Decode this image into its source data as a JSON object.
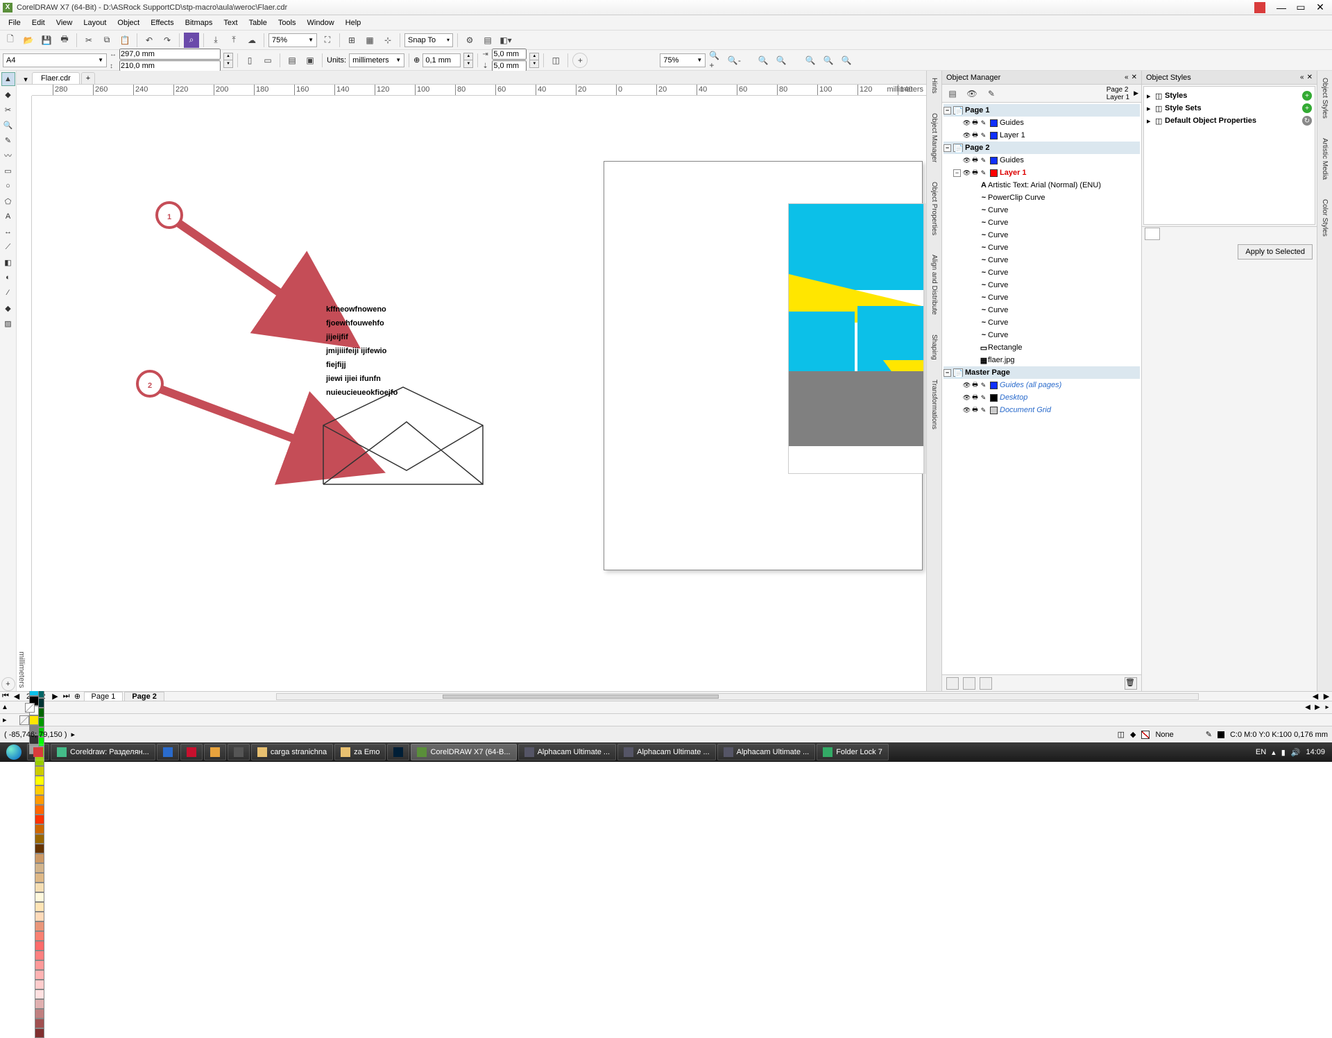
{
  "app_title": "CorelDRAW X7 (64-Bit) - D:\\ASRock SupportCD\\stp-macro\\aula\\weroc\\Flaer.cdr",
  "menu": [
    "File",
    "Edit",
    "View",
    "Layout",
    "Object",
    "Effects",
    "Bitmaps",
    "Text",
    "Table",
    "Tools",
    "Window",
    "Help"
  ],
  "zoom_main": "75%",
  "snap_label": "Snap To",
  "prop": {
    "page_size": "A4",
    "width": "297,0 mm",
    "height": "210,0 mm",
    "units_label": "Units:",
    "units_value": "millimeters",
    "nudge": "0,1 mm",
    "dup_x": "5,0 mm",
    "dup_y": "5,0 mm"
  },
  "zoom_right": "75%",
  "doc_tab": "Flaer.cdr",
  "ruler_marks": [
    280,
    260,
    240,
    220,
    200,
    180,
    160,
    140,
    120,
    100,
    80,
    60,
    40,
    20,
    0,
    20,
    40,
    60,
    80,
    100,
    120,
    140
  ],
  "ruler_unit": "millimeters",
  "canvas_text": [
    "kffneowfnoweno",
    "fjoewhfouwehfo",
    "jijeijfif",
    "jmijiiifeiji ijifewio",
    "fiejfijj",
    "jiewi ijiei ifunfn",
    "nuieucieueokfioejfo"
  ],
  "callouts": [
    "1",
    "2"
  ],
  "om": {
    "title": "Object Manager",
    "current_page": "Page 2",
    "current_layer": "Layer 1",
    "pages": [
      {
        "name": "Page 1",
        "layers": [
          {
            "name": "Guides",
            "color": "#1030ff"
          },
          {
            "name": "Layer 1",
            "color": "#1030ff"
          }
        ]
      },
      {
        "name": "Page 2",
        "layers": [
          {
            "name": "Guides",
            "color": "#1030ff"
          },
          {
            "name": "Layer 1",
            "color": "#ff0000",
            "active": true,
            "objects": [
              {
                "label": "Artistic Text: Arial (Normal) (ENU)",
                "icon": "A"
              },
              {
                "label": "PowerClip Curve",
                "icon": "~"
              },
              {
                "label": "Curve",
                "icon": "~"
              },
              {
                "label": "Curve",
                "icon": "~"
              },
              {
                "label": "Curve",
                "icon": "~"
              },
              {
                "label": "Curve",
                "icon": "~"
              },
              {
                "label": "Curve",
                "icon": "~"
              },
              {
                "label": "Curve",
                "icon": "~"
              },
              {
                "label": "Curve",
                "icon": "~"
              },
              {
                "label": "Curve",
                "icon": "~"
              },
              {
                "label": "Curve",
                "icon": "~"
              },
              {
                "label": "Curve",
                "icon": "~"
              },
              {
                "label": "Curve",
                "icon": "~"
              },
              {
                "label": "Rectangle",
                "icon": "▭"
              },
              {
                "label": "flaer.jpg",
                "icon": "▦"
              }
            ]
          }
        ]
      }
    ],
    "master": {
      "name": "Master Page",
      "layers": [
        {
          "name": "Guides (all pages)",
          "color": "#1030ff",
          "italic": true
        },
        {
          "name": "Desktop",
          "color": "#000000",
          "italic": true
        },
        {
          "name": "Document Grid",
          "color": "#cccccc",
          "italic": true
        }
      ]
    }
  },
  "styles": {
    "title": "Object Styles",
    "items": [
      "Styles",
      "Style Sets",
      "Default Object Properties"
    ],
    "apply": "Apply to Selected"
  },
  "right_tabs": [
    "Hints",
    "Object Manager",
    "Object Properties",
    "Align and Distribute",
    "Shaping",
    "Transformations"
  ],
  "far_tabs": [
    "Object Styles",
    "Artistic Media",
    "Color Styles"
  ],
  "pagenav": {
    "count": "2 of 2",
    "tabs": [
      "Page 1",
      "Page 2"
    ],
    "active": 1
  },
  "palette_colors": [
    "#000000",
    "#ffffff",
    "#1a1a1a",
    "#333333",
    "#4d4d4d",
    "#666666",
    "#808080",
    "#999999",
    "#b3b3b3",
    "#cccccc",
    "#e6e6e6",
    "#660000",
    "#990000",
    "#cc0000",
    "#ff0000",
    "#cc0066",
    "#ff0099",
    "#ff33cc",
    "#ff66cc",
    "#cc3399",
    "#993399",
    "#663399",
    "#330099",
    "#0000cc",
    "#0000ff",
    "#0033cc",
    "#0066cc",
    "#0099cc",
    "#00cccc",
    "#33cccc",
    "#66cccc",
    "#009999",
    "#006666",
    "#003333",
    "#006600",
    "#009900",
    "#00cc00",
    "#00ff00",
    "#66cc00",
    "#99cc00",
    "#cccc00",
    "#ffff00",
    "#ffcc00",
    "#ff9900",
    "#ff6600",
    "#ff3300",
    "#cc6600",
    "#996600",
    "#663300",
    "#cc9966",
    "#d2b48c",
    "#deb887",
    "#f5deb3",
    "#fff8dc",
    "#ffe4b5",
    "#ffdab9",
    "#e9967a",
    "#fa8072",
    "#ff6b6b",
    "#ff8080",
    "#ff9999",
    "#ffb3b3",
    "#ffcccc",
    "#ffe0e0",
    "#e0b0b0",
    "#c08080",
    "#a05050",
    "#803030"
  ],
  "doc_palette": [
    "#0cc0e8",
    "#000000",
    "#ffffff",
    "#ffe600",
    "#808080",
    "#333333",
    "#999999"
  ],
  "status": {
    "coords": "( -85,746; 79,150 )",
    "fill_label": "None",
    "outline": "C:0 M:0 Y:0 K:100  0,176 mm"
  },
  "taskbar": {
    "items": [
      {
        "label": "",
        "icon": "#d93c3c"
      },
      {
        "label": "Coreldraw: Разделян...",
        "icon": "#4b8"
      },
      {
        "label": "",
        "icon": "#2a6bcc"
      },
      {
        "label": "",
        "icon": "#c8102e"
      },
      {
        "label": "",
        "icon": "#e8a33d"
      },
      {
        "label": "",
        "icon": "#555"
      },
      {
        "label": "carga stranichna",
        "icon": "#e8c070"
      },
      {
        "label": "za Emo",
        "icon": "#e8c070"
      },
      {
        "label": "",
        "icon": "#001e36"
      },
      {
        "label": "CorelDRAW X7 (64-B...",
        "icon": "#5a8f3a",
        "active": true
      },
      {
        "label": "Alphacam Ultimate ...",
        "icon": "#556"
      },
      {
        "label": "Alphacam Ultimate ...",
        "icon": "#556"
      },
      {
        "label": "Alphacam Ultimate ...",
        "icon": "#556"
      },
      {
        "label": "Folder Lock 7",
        "icon": "#3a6"
      }
    ],
    "lang": "EN",
    "time": "14:09"
  }
}
